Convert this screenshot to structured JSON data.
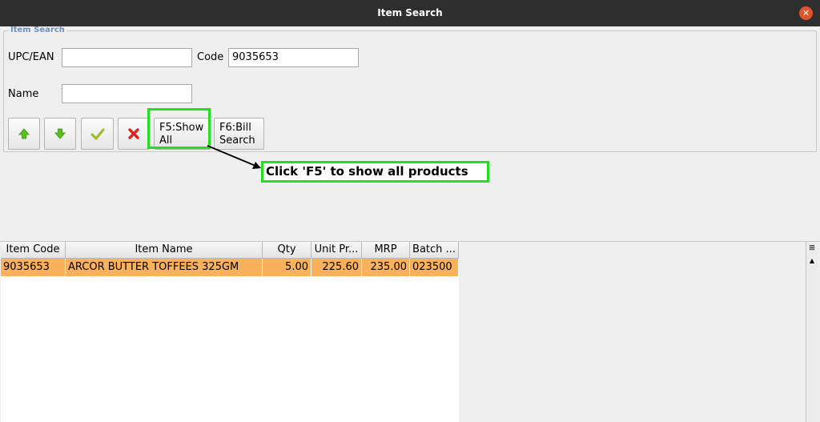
{
  "window": {
    "title": "Item Search",
    "close_glyph": "✕"
  },
  "form": {
    "legend": "Item Search",
    "upc_label": "UPC/EAN",
    "upc_value": "",
    "code_label": "Code",
    "code_value": "9035653",
    "name_label": "Name",
    "name_value": ""
  },
  "toolbar": {
    "up_icon": "arrow-up-icon",
    "down_icon": "arrow-down-icon",
    "ok_icon": "checkmark-icon",
    "cancel_icon": "cross-icon",
    "show_all_label": "F5:Show\nAll",
    "bill_search_label": "F6:Bill\nSearch"
  },
  "annotation": {
    "text": "Click 'F5' to show all products",
    "color": "#22e01f"
  },
  "table": {
    "columns": [
      "Item Code",
      "Item Name",
      "Qty",
      "Unit Pr...",
      "MRP",
      "Batch ..."
    ],
    "rows": [
      [
        "9035653",
        "ARCOR BUTTER TOFFEES 325GM",
        "5.00",
        "225.60",
        "235.00",
        "023500"
      ]
    ],
    "selected_row_color": "#f9b25b"
  },
  "scrollbar": {
    "corner_glyph": "⊞",
    "up_glyph": "▲"
  }
}
